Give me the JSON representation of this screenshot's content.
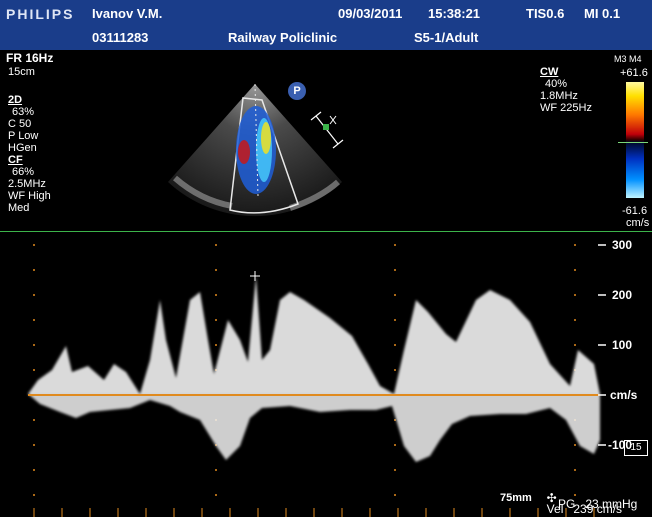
{
  "header": {
    "brand": "PHILIPS",
    "patient_name": "Ivanov V.M.",
    "date": "09/03/2011",
    "time": "15:38:21",
    "tis": "TIS0.6",
    "mi": "MI 0.1",
    "patient_id": "03111283",
    "institution": "Railway Policlinic",
    "preset": "S5-1/Adult"
  },
  "left_params": {
    "fr": "FR 16Hz",
    "depth": "15cm",
    "mode_2d": "2D",
    "gain_2d": "63%",
    "compress": "C 50",
    "power": "P Low",
    "harmonic": "HGen",
    "mode_cf": "CF",
    "gain_cf": "66%",
    "freq_cf": "2.5MHz",
    "filter_cf": "WF High",
    "filter_level": "Med"
  },
  "right_params": {
    "mode_cw": "CW",
    "gain_cw": "40%",
    "freq_cw": "1.8MHz",
    "filter_cw": "WF 225Hz"
  },
  "color_scale": {
    "labels": "M3 M4",
    "top_value": "+61.6",
    "bottom_value": "-61.6",
    "unit": "cm/s"
  },
  "probe_marker": "P",
  "spectral": {
    "axis_labels": [
      "300",
      "200",
      "100",
      "cm/s",
      "-100"
    ],
    "box_value": "15",
    "sweep": "75mm",
    "vel": "Vel   239 cm/s",
    "pg": "PG   23 mmHg",
    "baseline_color": "#e08a1e",
    "separator_color": "#3cb34a"
  }
}
